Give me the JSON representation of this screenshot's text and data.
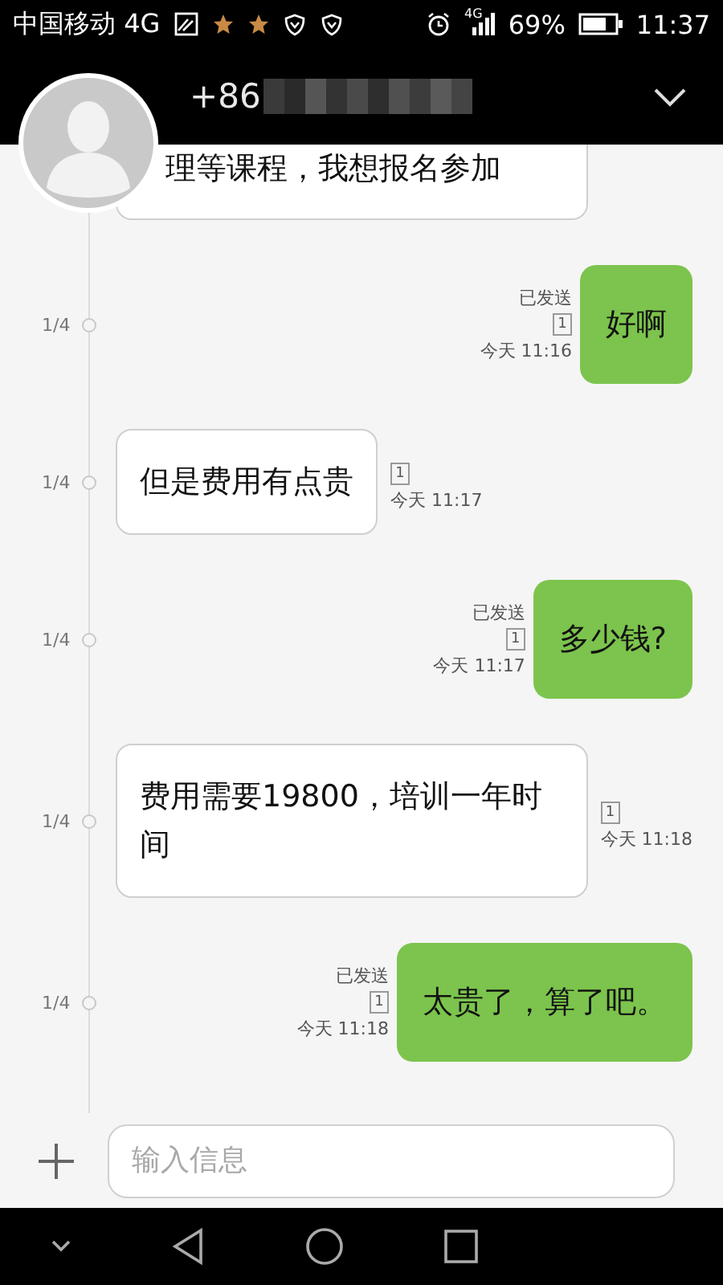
{
  "status_bar": {
    "carrier": "中国移动 4G",
    "network": "4G",
    "battery": "69%",
    "time": "11:37"
  },
  "header": {
    "contact": "+86"
  },
  "messages": [
    {
      "kind": "received-partial",
      "text": "理等课程，我想报名参加"
    },
    {
      "kind": "sent",
      "slot": "1/4",
      "status": "已发送",
      "sim": "1",
      "time": "今天 11:16",
      "text": "好啊"
    },
    {
      "kind": "received",
      "slot": "1/4",
      "sim": "1",
      "time": "今天 11:17",
      "text": "但是费用有点贵"
    },
    {
      "kind": "sent",
      "slot": "1/4",
      "status": "已发送",
      "sim": "1",
      "time": "今天 11:17",
      "text": "多少钱?"
    },
    {
      "kind": "received",
      "slot": "1/4",
      "sim": "1",
      "time": "今天 11:18",
      "text": "费用需要19800，培训一年时间"
    },
    {
      "kind": "sent",
      "slot": "1/4",
      "status": "已发送",
      "sim": "1",
      "time": "今天 11:18",
      "text": "太贵了，算了吧。"
    }
  ],
  "composer": {
    "placeholder": "输入信息"
  }
}
